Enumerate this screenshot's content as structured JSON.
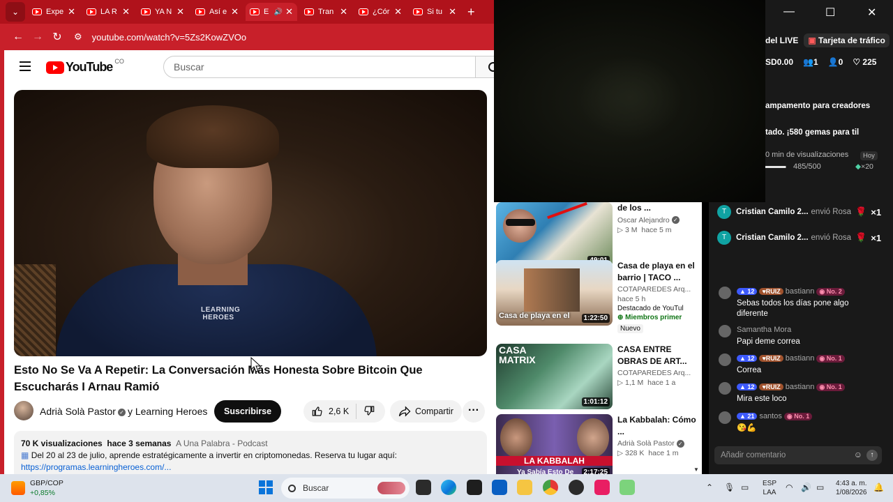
{
  "browser": {
    "tabs": [
      {
        "label": "Expe"
      },
      {
        "label": "LA R"
      },
      {
        "label": "YA N"
      },
      {
        "label": "Así e"
      },
      {
        "label": "E",
        "active": true
      },
      {
        "label": "Tran"
      },
      {
        "label": "¿Cór"
      },
      {
        "label": "Si tu"
      }
    ],
    "new_tab": "+",
    "url": "youtube.com/watch?v=5Zs2KowZVOo"
  },
  "youtube": {
    "logo": "YouTube",
    "country": "CO",
    "search_placeholder": "Buscar",
    "video": {
      "title": "Esto No Se Va A Repetir: La Conversación Más Honesta Sobre Bitcoin Que Escucharás I Arnau Ramió",
      "shirt_text": "LEARNING HEROES",
      "channel": "Adrià Solà Pastor",
      "collab": "y Learning Heroes",
      "subscribe": "Suscribirse",
      "likes": "2,6 K",
      "share": "Compartir",
      "more": "···",
      "views": "70 K visualizaciones",
      "age": "hace 3 semanas",
      "tag": "A Una Palabra - Podcast",
      "desc_line": "Del 20 al 23 de julio, aprende estratégicamente a invertir en criptomonedas. Reserva tu lugar aquí:",
      "desc_link": "https://programas.learningheroes.com/..."
    },
    "recommendations": [
      {
        "title": "de los ...",
        "channel": "Oscar Alejandro",
        "verified": true,
        "views": "3 M",
        "age": "hace 5 m",
        "duration": "49:01"
      },
      {
        "title": "Casa de playa en el barrio | TACO ...",
        "channel": "COTAPAREDES Arq...",
        "age_only": "hace 5 h",
        "featured": "Destacado de YouTul",
        "members": "Miembros primer",
        "badge": "Nuevo",
        "duration": "1:22:50",
        "thumb_text": "Casa de playa en el"
      },
      {
        "title": "CASA ENTRE OBRAS DE ART...",
        "channel": "COTAPAREDES Arq...",
        "views": "1,1 M",
        "age": "hace 1 a",
        "duration": "1:01:12",
        "thumb_text": "CASA MATRIX"
      },
      {
        "title": "La Kabbalah: Cómo ...",
        "channel": "Adrià Solà Pastor",
        "verified": true,
        "views": "328 K",
        "age": "hace 1 m",
        "duration": "2:17:25",
        "thumb_text": "LA KABBALAH",
        "thumb_sub": "Ya Sabía Esto De"
      }
    ]
  },
  "live": {
    "tab_live": "del LIVE",
    "traffic_card": "Tarjeta de tráfico",
    "stats": {
      "money": "SD0.00",
      "viewers": "1",
      "follows": "0",
      "likes": "225"
    },
    "camp": "ampamento para creadores",
    "gems": "tado. ¡580 gemas para til",
    "watch": "0 min de visualizaciones",
    "hoy": "Hoy",
    "progress": "485/500",
    "progress_fraction": 0.97,
    "multiplier": "×20",
    "gifts": [
      {
        "initial": "T",
        "name": "Cristian Camilo 2...",
        "action": "envió Rosa",
        "count": "×1"
      },
      {
        "initial": "T",
        "name": "Cristian Camilo 2...",
        "action": "envió Rosa",
        "count": "×1"
      }
    ],
    "comments": [
      {
        "level": "12",
        "fan": "RUIZ",
        "user": "bastiann",
        "rank": "No. 2",
        "text": "Sebas todos los días pone algo diferente"
      },
      {
        "user": "Samantha Mora",
        "text": "Papi deme correa"
      },
      {
        "level": "12",
        "fan": "RUIZ",
        "user": "bastiann",
        "rank": "No. 1",
        "text": "Correa"
      },
      {
        "level": "12",
        "fan": "RUIZ",
        "user": "bastiann",
        "rank": "No. 1",
        "text": "Mira este loco"
      },
      {
        "level": "21",
        "user": "santos",
        "rank": "No. 1",
        "text": "😘💪"
      }
    ],
    "add_comment": "Añadir comentario"
  },
  "taskbar": {
    "stock_pair": "GBP/COP",
    "stock_change": "+0,85%",
    "search": "Buscar",
    "lang": "ESP",
    "lang2": "LAA",
    "time": "4:43 a. m.",
    "date": "1/08/2026"
  },
  "colors": {
    "chrome_red": "#c8202a",
    "yt_red": "#ff0000",
    "live_bg": "#191919"
  }
}
